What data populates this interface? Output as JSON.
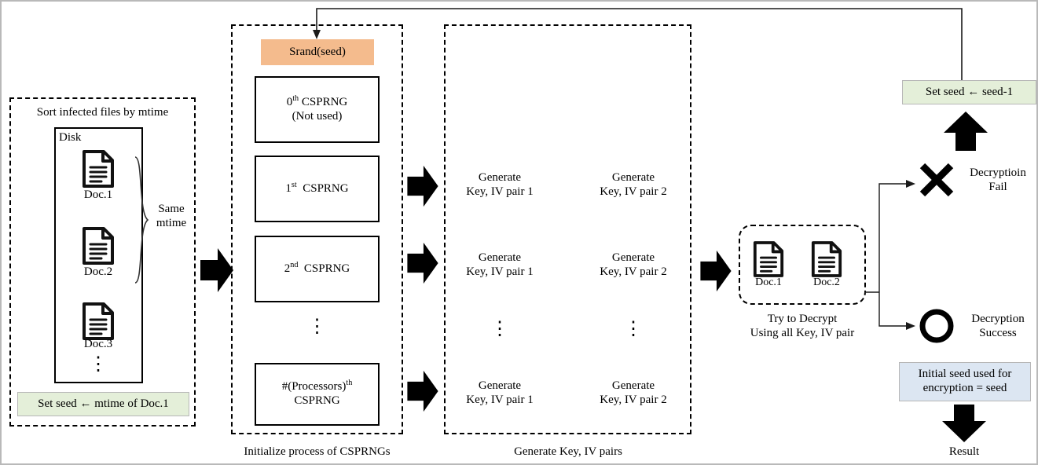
{
  "diagram": {
    "title": "Ransomware key recovery flow",
    "colors": {
      "srand_fill": "#f4bb8d",
      "seed_green_fill": "#e4efd9",
      "result_blue_fill": "#dce6f2",
      "stroke": "#000000",
      "frame_border": "#b9b9b9"
    }
  },
  "stage1": {
    "caption": "Sort infected files by mtime",
    "disk_label": "Disk",
    "docs": [
      {
        "label": "Doc.1"
      },
      {
        "label": "Doc.2"
      },
      {
        "label": "Doc.3"
      }
    ],
    "ellipsis": "⋮",
    "brace_label_line1": "Same",
    "brace_label_line2": "mtime",
    "seed_box": "Set seed ← mtime of Doc.1"
  },
  "stage2": {
    "srand": "Srand(seed)",
    "items": [
      {
        "ordinal": "0",
        "sup": "th",
        "name": "CSPRNG",
        "note": "(Not used)"
      },
      {
        "ordinal": "1",
        "sup": "st",
        "name": "CSPRNG",
        "note": ""
      },
      {
        "ordinal": "2",
        "sup": "nd",
        "name": "CSPRNG",
        "note": ""
      },
      {
        "ordinal": "#(Processors)",
        "sup": "th",
        "name": "CSPRNG",
        "note": ""
      }
    ],
    "ellipsis": "⋮",
    "caption": "Initialize  process of CSPRNGs"
  },
  "stage3": {
    "rows": [
      {
        "left_line1": "Generate",
        "left_line2": "Key, IV pair  1",
        "right_line1": "Generate",
        "right_line2": "Key, IV pair 2"
      },
      {
        "left_line1": "Generate",
        "left_line2": "Key, IV pair  1",
        "right_line1": "Generate",
        "right_line2": "Key, IV pair 2"
      },
      {
        "left_line1": "Generate",
        "left_line2": "Key, IV pair  1",
        "right_line1": "Generate",
        "right_line2": "Key, IV pair 2"
      }
    ],
    "ellipsis": "⋮",
    "caption": "Generate Key, IV pairs"
  },
  "stage4": {
    "docs": [
      {
        "label": "Doc.1"
      },
      {
        "label": "Doc.2"
      }
    ],
    "caption_line1": "Try to Decrypt",
    "caption_line2": "Using all Key, IV pair"
  },
  "stage5": {
    "retry_box": "Set seed ← seed-1",
    "fail_line1": "Decryptioin",
    "fail_line2": "Fail",
    "fail_icon": "cross-mark",
    "success_line1": "Decryption",
    "success_line2": "Success",
    "success_icon": "circle-mark",
    "result_box_line1": "Initial  seed used for",
    "result_box_line2": "encryption = seed",
    "caption": "Result"
  }
}
